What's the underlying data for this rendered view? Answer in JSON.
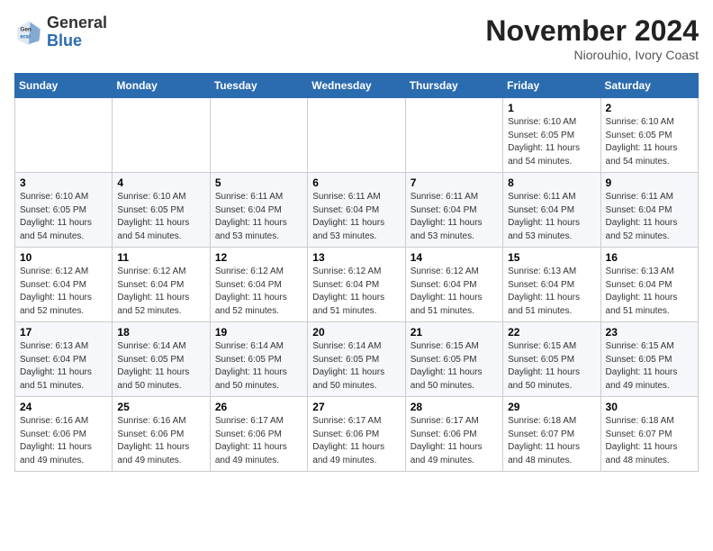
{
  "header": {
    "logo_line1": "General",
    "logo_line2": "Blue",
    "month": "November 2024",
    "location": "Niorouhio, Ivory Coast"
  },
  "weekdays": [
    "Sunday",
    "Monday",
    "Tuesday",
    "Wednesday",
    "Thursday",
    "Friday",
    "Saturday"
  ],
  "weeks": [
    [
      {
        "day": "",
        "info": ""
      },
      {
        "day": "",
        "info": ""
      },
      {
        "day": "",
        "info": ""
      },
      {
        "day": "",
        "info": ""
      },
      {
        "day": "",
        "info": ""
      },
      {
        "day": "1",
        "info": "Sunrise: 6:10 AM\nSunset: 6:05 PM\nDaylight: 11 hours\nand 54 minutes."
      },
      {
        "day": "2",
        "info": "Sunrise: 6:10 AM\nSunset: 6:05 PM\nDaylight: 11 hours\nand 54 minutes."
      }
    ],
    [
      {
        "day": "3",
        "info": "Sunrise: 6:10 AM\nSunset: 6:05 PM\nDaylight: 11 hours\nand 54 minutes."
      },
      {
        "day": "4",
        "info": "Sunrise: 6:10 AM\nSunset: 6:05 PM\nDaylight: 11 hours\nand 54 minutes."
      },
      {
        "day": "5",
        "info": "Sunrise: 6:11 AM\nSunset: 6:04 PM\nDaylight: 11 hours\nand 53 minutes."
      },
      {
        "day": "6",
        "info": "Sunrise: 6:11 AM\nSunset: 6:04 PM\nDaylight: 11 hours\nand 53 minutes."
      },
      {
        "day": "7",
        "info": "Sunrise: 6:11 AM\nSunset: 6:04 PM\nDaylight: 11 hours\nand 53 minutes."
      },
      {
        "day": "8",
        "info": "Sunrise: 6:11 AM\nSunset: 6:04 PM\nDaylight: 11 hours\nand 53 minutes."
      },
      {
        "day": "9",
        "info": "Sunrise: 6:11 AM\nSunset: 6:04 PM\nDaylight: 11 hours\nand 52 minutes."
      }
    ],
    [
      {
        "day": "10",
        "info": "Sunrise: 6:12 AM\nSunset: 6:04 PM\nDaylight: 11 hours\nand 52 minutes."
      },
      {
        "day": "11",
        "info": "Sunrise: 6:12 AM\nSunset: 6:04 PM\nDaylight: 11 hours\nand 52 minutes."
      },
      {
        "day": "12",
        "info": "Sunrise: 6:12 AM\nSunset: 6:04 PM\nDaylight: 11 hours\nand 52 minutes."
      },
      {
        "day": "13",
        "info": "Sunrise: 6:12 AM\nSunset: 6:04 PM\nDaylight: 11 hours\nand 51 minutes."
      },
      {
        "day": "14",
        "info": "Sunrise: 6:12 AM\nSunset: 6:04 PM\nDaylight: 11 hours\nand 51 minutes."
      },
      {
        "day": "15",
        "info": "Sunrise: 6:13 AM\nSunset: 6:04 PM\nDaylight: 11 hours\nand 51 minutes."
      },
      {
        "day": "16",
        "info": "Sunrise: 6:13 AM\nSunset: 6:04 PM\nDaylight: 11 hours\nand 51 minutes."
      }
    ],
    [
      {
        "day": "17",
        "info": "Sunrise: 6:13 AM\nSunset: 6:04 PM\nDaylight: 11 hours\nand 51 minutes."
      },
      {
        "day": "18",
        "info": "Sunrise: 6:14 AM\nSunset: 6:05 PM\nDaylight: 11 hours\nand 50 minutes."
      },
      {
        "day": "19",
        "info": "Sunrise: 6:14 AM\nSunset: 6:05 PM\nDaylight: 11 hours\nand 50 minutes."
      },
      {
        "day": "20",
        "info": "Sunrise: 6:14 AM\nSunset: 6:05 PM\nDaylight: 11 hours\nand 50 minutes."
      },
      {
        "day": "21",
        "info": "Sunrise: 6:15 AM\nSunset: 6:05 PM\nDaylight: 11 hours\nand 50 minutes."
      },
      {
        "day": "22",
        "info": "Sunrise: 6:15 AM\nSunset: 6:05 PM\nDaylight: 11 hours\nand 50 minutes."
      },
      {
        "day": "23",
        "info": "Sunrise: 6:15 AM\nSunset: 6:05 PM\nDaylight: 11 hours\nand 49 minutes."
      }
    ],
    [
      {
        "day": "24",
        "info": "Sunrise: 6:16 AM\nSunset: 6:06 PM\nDaylight: 11 hours\nand 49 minutes."
      },
      {
        "day": "25",
        "info": "Sunrise: 6:16 AM\nSunset: 6:06 PM\nDaylight: 11 hours\nand 49 minutes."
      },
      {
        "day": "26",
        "info": "Sunrise: 6:17 AM\nSunset: 6:06 PM\nDaylight: 11 hours\nand 49 minutes."
      },
      {
        "day": "27",
        "info": "Sunrise: 6:17 AM\nSunset: 6:06 PM\nDaylight: 11 hours\nand 49 minutes."
      },
      {
        "day": "28",
        "info": "Sunrise: 6:17 AM\nSunset: 6:06 PM\nDaylight: 11 hours\nand 49 minutes."
      },
      {
        "day": "29",
        "info": "Sunrise: 6:18 AM\nSunset: 6:07 PM\nDaylight: 11 hours\nand 48 minutes."
      },
      {
        "day": "30",
        "info": "Sunrise: 6:18 AM\nSunset: 6:07 PM\nDaylight: 11 hours\nand 48 minutes."
      }
    ]
  ]
}
